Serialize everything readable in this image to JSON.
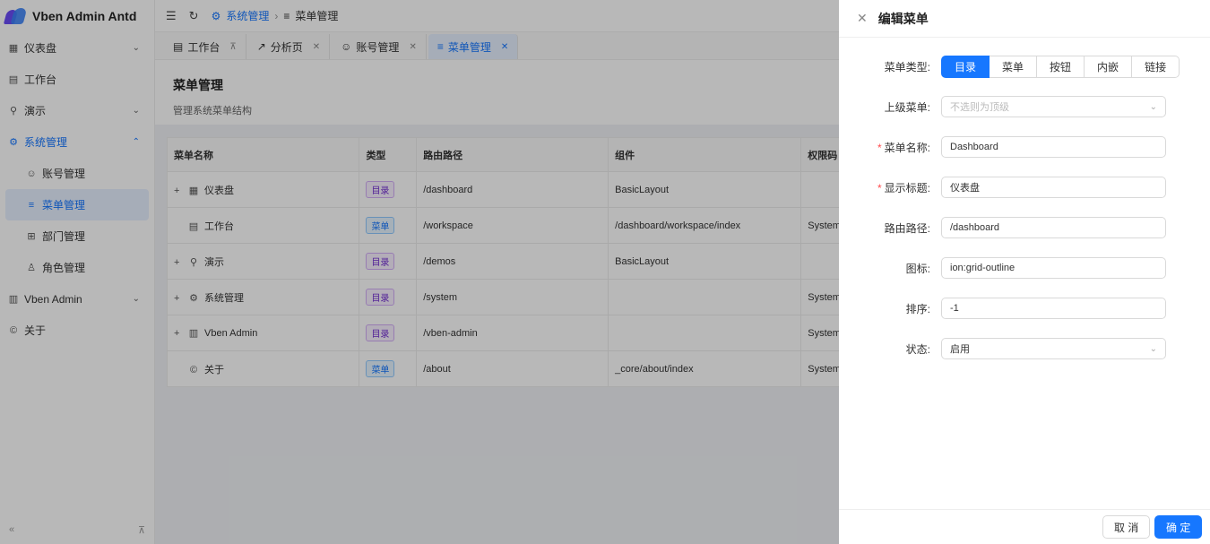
{
  "app": {
    "title": "Vben Admin Antd"
  },
  "sidebar": {
    "items": [
      {
        "label": "仪表盘",
        "icon": "grid-icon",
        "has_children": true
      },
      {
        "label": "工作台",
        "icon": "workspace-icon",
        "has_children": false
      },
      {
        "label": "演示",
        "icon": "wrench-icon",
        "has_children": true
      },
      {
        "label": "系统管理",
        "icon": "gear-icon",
        "has_children": true,
        "expanded": true
      },
      {
        "label": "账号管理",
        "icon": "user-icon"
      },
      {
        "label": "菜单管理",
        "icon": "menu-list-icon",
        "selected": true
      },
      {
        "label": "部门管理",
        "icon": "org-icon"
      },
      {
        "label": "角色管理",
        "icon": "role-icon"
      },
      {
        "label": "Vben Admin",
        "icon": "building-icon",
        "has_children": true
      },
      {
        "label": "关于",
        "icon": "copyright-icon",
        "has_children": false
      }
    ]
  },
  "header": {
    "breadcrumb": [
      "系统管理",
      "菜单管理"
    ]
  },
  "tabs": [
    {
      "label": "工作台",
      "pinned": true
    },
    {
      "label": "分析页"
    },
    {
      "label": "账号管理"
    },
    {
      "label": "菜单管理",
      "active": true
    }
  ],
  "page": {
    "title": "菜单管理",
    "description": "管理系统菜单结构"
  },
  "table": {
    "columns": [
      "菜单名称",
      "类型",
      "路由路径",
      "组件",
      "权限码"
    ],
    "rows": [
      {
        "name": "仪表盘",
        "type": "目录",
        "path": "/dashboard",
        "component": "BasicLayout",
        "perm": "",
        "expandable": true
      },
      {
        "name": "工作台",
        "type": "菜单",
        "path": "/workspace",
        "component": "/dashboard/workspace/index",
        "perm": "System",
        "expandable": false
      },
      {
        "name": "演示",
        "type": "目录",
        "path": "/demos",
        "component": "BasicLayout",
        "perm": "",
        "expandable": true
      },
      {
        "name": "系统管理",
        "type": "目录",
        "path": "/system",
        "component": "",
        "perm": "System",
        "expandable": true
      },
      {
        "name": "Vben Admin",
        "type": "目录",
        "path": "/vben-admin",
        "component": "",
        "perm": "System",
        "expandable": true
      },
      {
        "name": "关于",
        "type": "菜单",
        "path": "/about",
        "component": "_core/about/index",
        "perm": "System",
        "expandable": false
      }
    ]
  },
  "drawer": {
    "title": "编辑菜单",
    "type_label": "菜单类型:",
    "type_options": [
      "目录",
      "菜单",
      "按钮",
      "内嵌",
      "链接"
    ],
    "type_selected": "目录",
    "parent_label": "上级菜单:",
    "parent_placeholder": "不选则为顶级",
    "name_label": "菜单名称:",
    "name_value": "Dashboard",
    "display_title_label": "显示标题:",
    "display_title_value": "仪表盘",
    "path_label": "路由路径:",
    "path_value": "/dashboard",
    "icon_label": "图标:",
    "icon_value": "ion:grid-outline",
    "order_label": "排序:",
    "order_value": "-1",
    "status_label": "状态:",
    "status_value": "启用",
    "cancel_label": "取 消",
    "ok_label": "确 定"
  },
  "colors": {
    "primary": "#1677ff",
    "dir_badge": "#722ed1",
    "required": "#ff4d4f"
  }
}
